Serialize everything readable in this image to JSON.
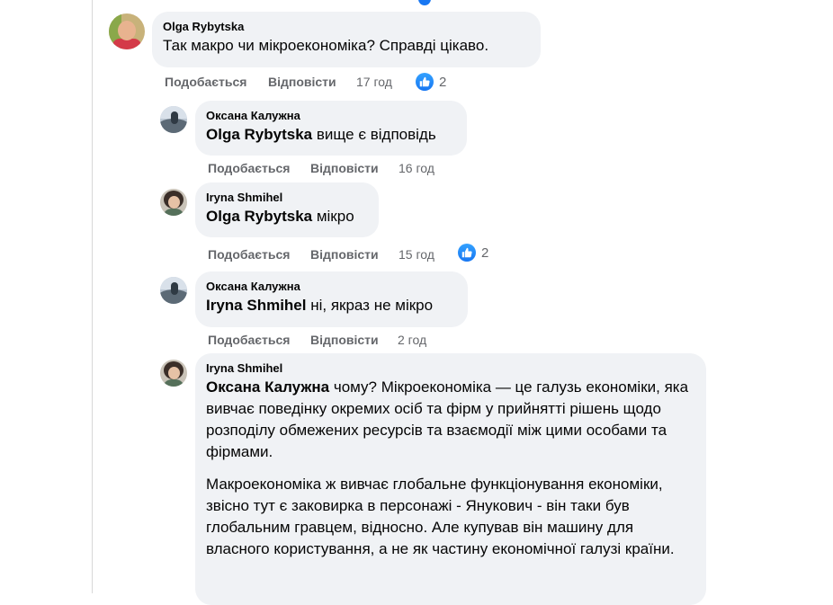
{
  "comments": [
    {
      "author": "Olga Rybytska",
      "text": "Так макро чи мікроекономіка? Справді цікаво.",
      "like_label": "Подобається",
      "reply_label": "Відповісти",
      "time": "17 год",
      "reaction_count": "2"
    },
    {
      "author": "Оксана Калужна",
      "mention": "Olga Rybytska",
      "text": " вище є відповідь",
      "like_label": "Подобається",
      "reply_label": "Відповісти",
      "time": "16 год"
    },
    {
      "author": "Iryna Shmihel",
      "mention": "Olga Rybytska",
      "text": " мікро",
      "like_label": "Подобається",
      "reply_label": "Відповісти",
      "time": "15 год",
      "reaction_count": "2"
    },
    {
      "author": "Оксана Калужна",
      "mention": "Iryna Shmihel",
      "text": " ні, якраз не мікро",
      "like_label": "Подобається",
      "reply_label": "Відповісти",
      "time": "2 год"
    },
    {
      "author": "Iryna Shmihel",
      "mention": "Оксана Калужна",
      "text": " чому? Мікроекономіка — це галузь економіки, яка вивчає поведінку окремих осіб та фірм у прийнятті рішень щодо розподілу обмежених ресурсів та взаємодії між цими особами та фірмами.",
      "paragraph2": "Макроекономіка ж вивчає глобальне функціонування економіки, звісно тут є заковирка в персонажі - Янукович - він таки був глобальним гравцем, відносно. Але купував він машину для власного користування, а не як частину економічної галузі країни."
    }
  ],
  "colors": {
    "bubble": "#f0f2f5",
    "meta": "#65676b",
    "like_blue": "#1877f2"
  },
  "icons": {
    "reaction": "like-thumb-icon"
  }
}
